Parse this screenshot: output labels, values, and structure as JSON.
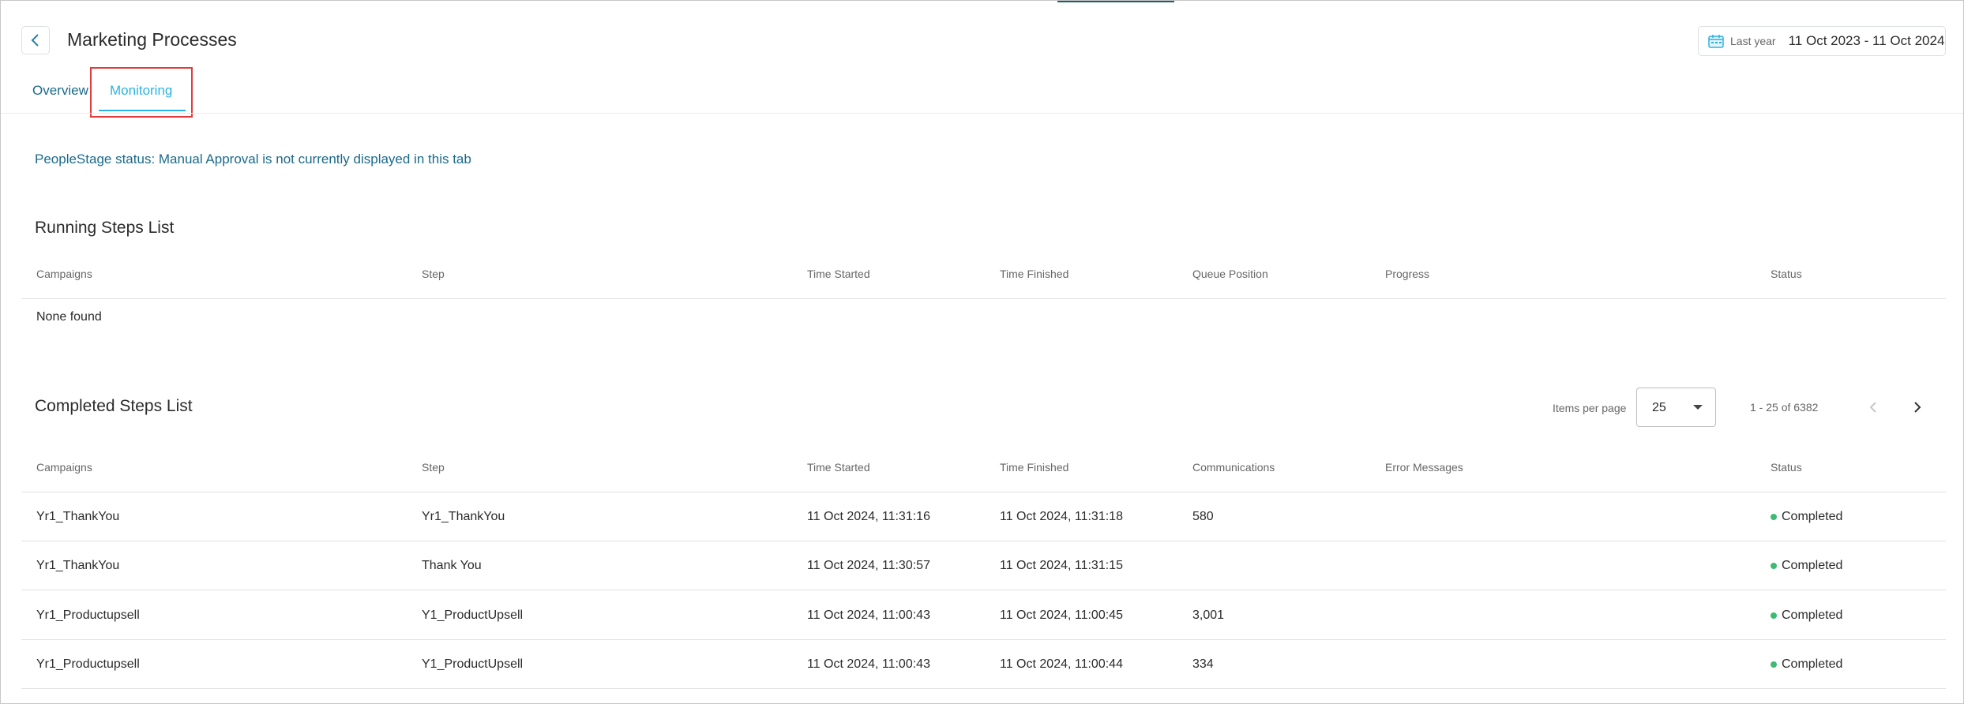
{
  "header": {
    "title": "Marketing Processes",
    "date_preset": "Last year",
    "date_range": "11 Oct 2023 - 11 Oct 2024"
  },
  "tabs": [
    {
      "label": "Overview",
      "active": false
    },
    {
      "label": "Monitoring",
      "active": true
    }
  ],
  "status_note": "PeopleStage status: Manual Approval is not currently displayed in this tab",
  "running": {
    "title": "Running Steps List",
    "columns": [
      "Campaigns",
      "Step",
      "Time Started",
      "Time Finished",
      "Queue Position",
      "Progress",
      "Status"
    ],
    "empty_text": "None found"
  },
  "completed": {
    "title": "Completed Steps List",
    "items_per_page_label": "Items per page",
    "items_per_page": "25",
    "range_label": "1 - 25 of 6382",
    "columns": [
      "Campaigns",
      "Step",
      "Time Started",
      "Time Finished",
      "Communications",
      "Error Messages",
      "Status"
    ],
    "rows": [
      {
        "campaign": "Yr1_ThankYou",
        "step": "Yr1_ThankYou",
        "started": "11 Oct 2024, 11:31:16",
        "finished": "11 Oct 2024, 11:31:18",
        "communications": "580",
        "errors": "",
        "status": "Completed"
      },
      {
        "campaign": "Yr1_ThankYou",
        "step": "Thank You",
        "started": "11 Oct 2024, 11:30:57",
        "finished": "11 Oct 2024, 11:31:15",
        "communications": "",
        "errors": "",
        "status": "Completed"
      },
      {
        "campaign": "Yr1_Productupsell",
        "step": "Y1_ProductUpsell",
        "started": "11 Oct 2024, 11:00:43",
        "finished": "11 Oct 2024, 11:00:45",
        "communications": "3,001",
        "errors": "",
        "status": "Completed"
      },
      {
        "campaign": "Yr1_Productupsell",
        "step": "Y1_ProductUpsell",
        "started": "11 Oct 2024, 11:00:43",
        "finished": "11 Oct 2024, 11:00:44",
        "communications": "334",
        "errors": "",
        "status": "Completed"
      }
    ]
  },
  "colors": {
    "accent": "#2bb3e6",
    "link": "#1a6a8a",
    "status_completed": "#3dbb75",
    "highlight": "#e03c3c"
  },
  "icons": {
    "back": "chevron-left-icon",
    "calendar": "calendar-icon",
    "dropdown": "caret-down-icon",
    "prev_page": "chevron-left-icon",
    "next_page": "chevron-right-icon"
  }
}
